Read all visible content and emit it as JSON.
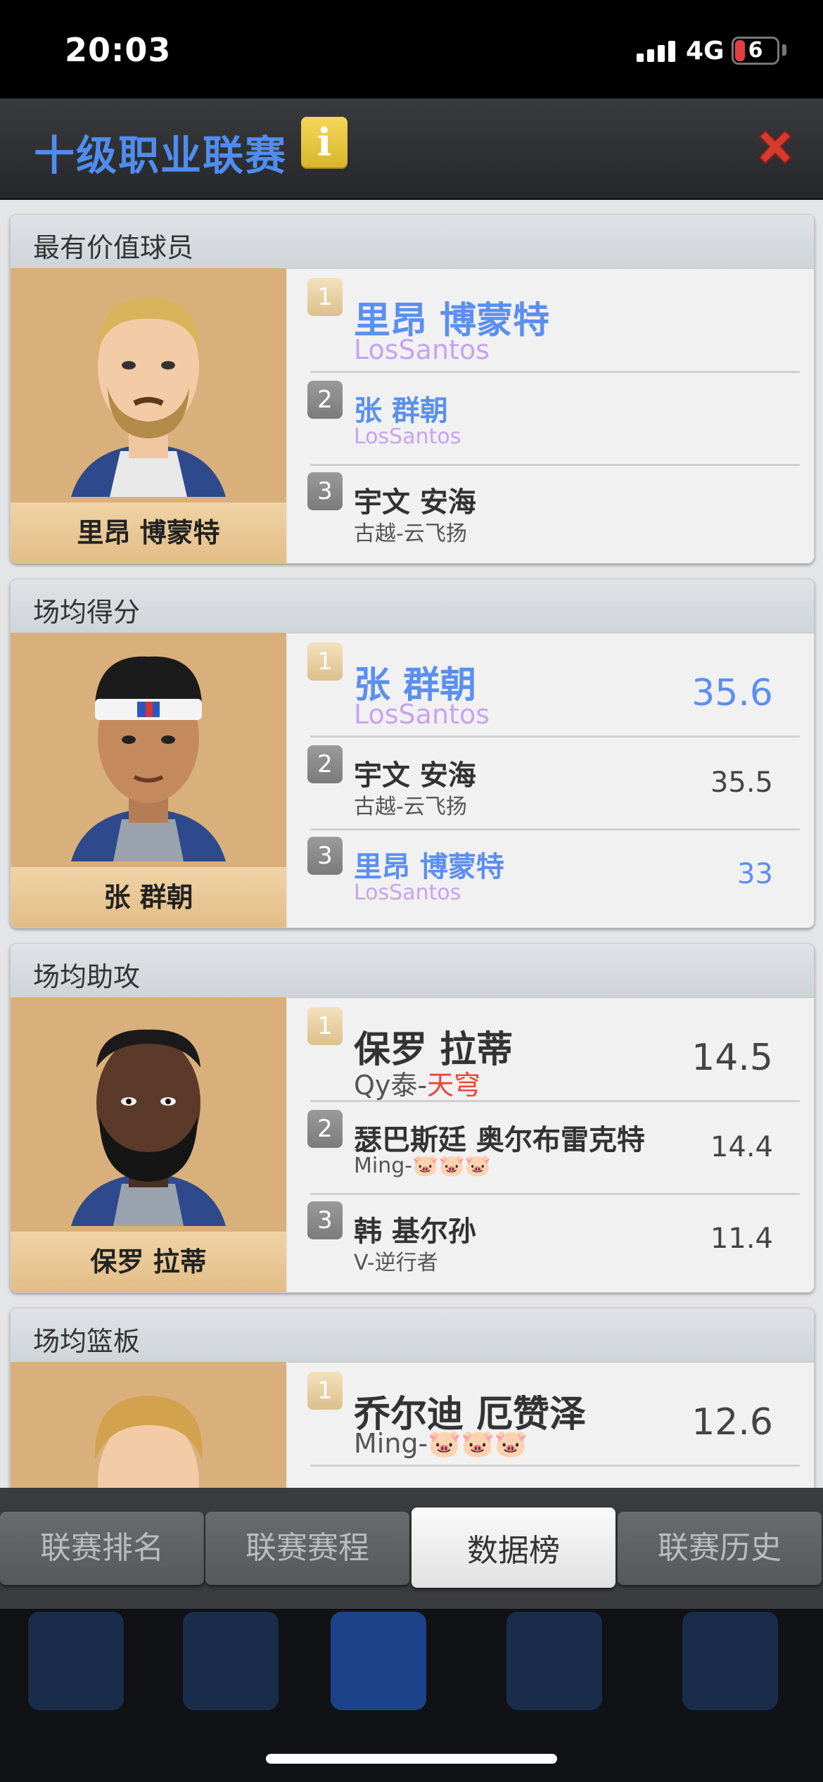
{
  "status_bar": {
    "time": "20:03",
    "network": "4G",
    "battery": "6"
  },
  "header": {
    "title": "十级职业联赛",
    "info_icon": "info-icon",
    "close_icon": "close-icon"
  },
  "cards": [
    {
      "title": "最有价值球员",
      "featured_name": "里昂 博蒙特",
      "rows": [
        {
          "rank": "1",
          "name": "里昂 博蒙特",
          "team": "LosSantos",
          "value": ""
        },
        {
          "rank": "2",
          "name": "张 群朝",
          "team": "LosSantos",
          "value": ""
        },
        {
          "rank": "3",
          "name": "宇文 安海",
          "team": "古越-云飞扬",
          "value": ""
        }
      ]
    },
    {
      "title": "场均得分",
      "featured_name": "张 群朝",
      "rows": [
        {
          "rank": "1",
          "name": "张 群朝",
          "team": "LosSantos",
          "value": "35.6"
        },
        {
          "rank": "2",
          "name": "宇文 安海",
          "team": "古越-云飞扬",
          "value": "35.5"
        },
        {
          "rank": "3",
          "name": "里昂 博蒙特",
          "team": "LosSantos",
          "value": "33"
        }
      ]
    },
    {
      "title": "场均助攻",
      "featured_name": "保罗 拉蒂",
      "rows": [
        {
          "rank": "1",
          "name": "保罗 拉蒂",
          "team_prefix": "Qy泰-",
          "team_highlight": "天穹",
          "value": "14.5"
        },
        {
          "rank": "2",
          "name": "瑟巴斯廷 奥尔布雷克特",
          "team": "Ming-🐷🐷🐷",
          "value": "14.4"
        },
        {
          "rank": "3",
          "name": "韩 基尔孙",
          "team": "V-逆行者",
          "value": "11.4"
        }
      ]
    },
    {
      "title": "场均篮板",
      "featured_name": "",
      "rows": [
        {
          "rank": "1",
          "name": "乔尔迪 厄赞泽",
          "team": "Ming-🐷🐷🐷",
          "value": "12.6"
        }
      ]
    }
  ],
  "tabs": [
    {
      "label": "联赛排名",
      "active": false
    },
    {
      "label": "联赛赛程",
      "active": false
    },
    {
      "label": "数据榜",
      "active": true
    },
    {
      "label": "联赛历史",
      "active": false
    }
  ],
  "colors": {
    "accent_blue": "#4f8df0",
    "team_purple": "#c8a3f0",
    "highlight_red": "#e8453c",
    "portrait_bg": "#d9b07b"
  }
}
